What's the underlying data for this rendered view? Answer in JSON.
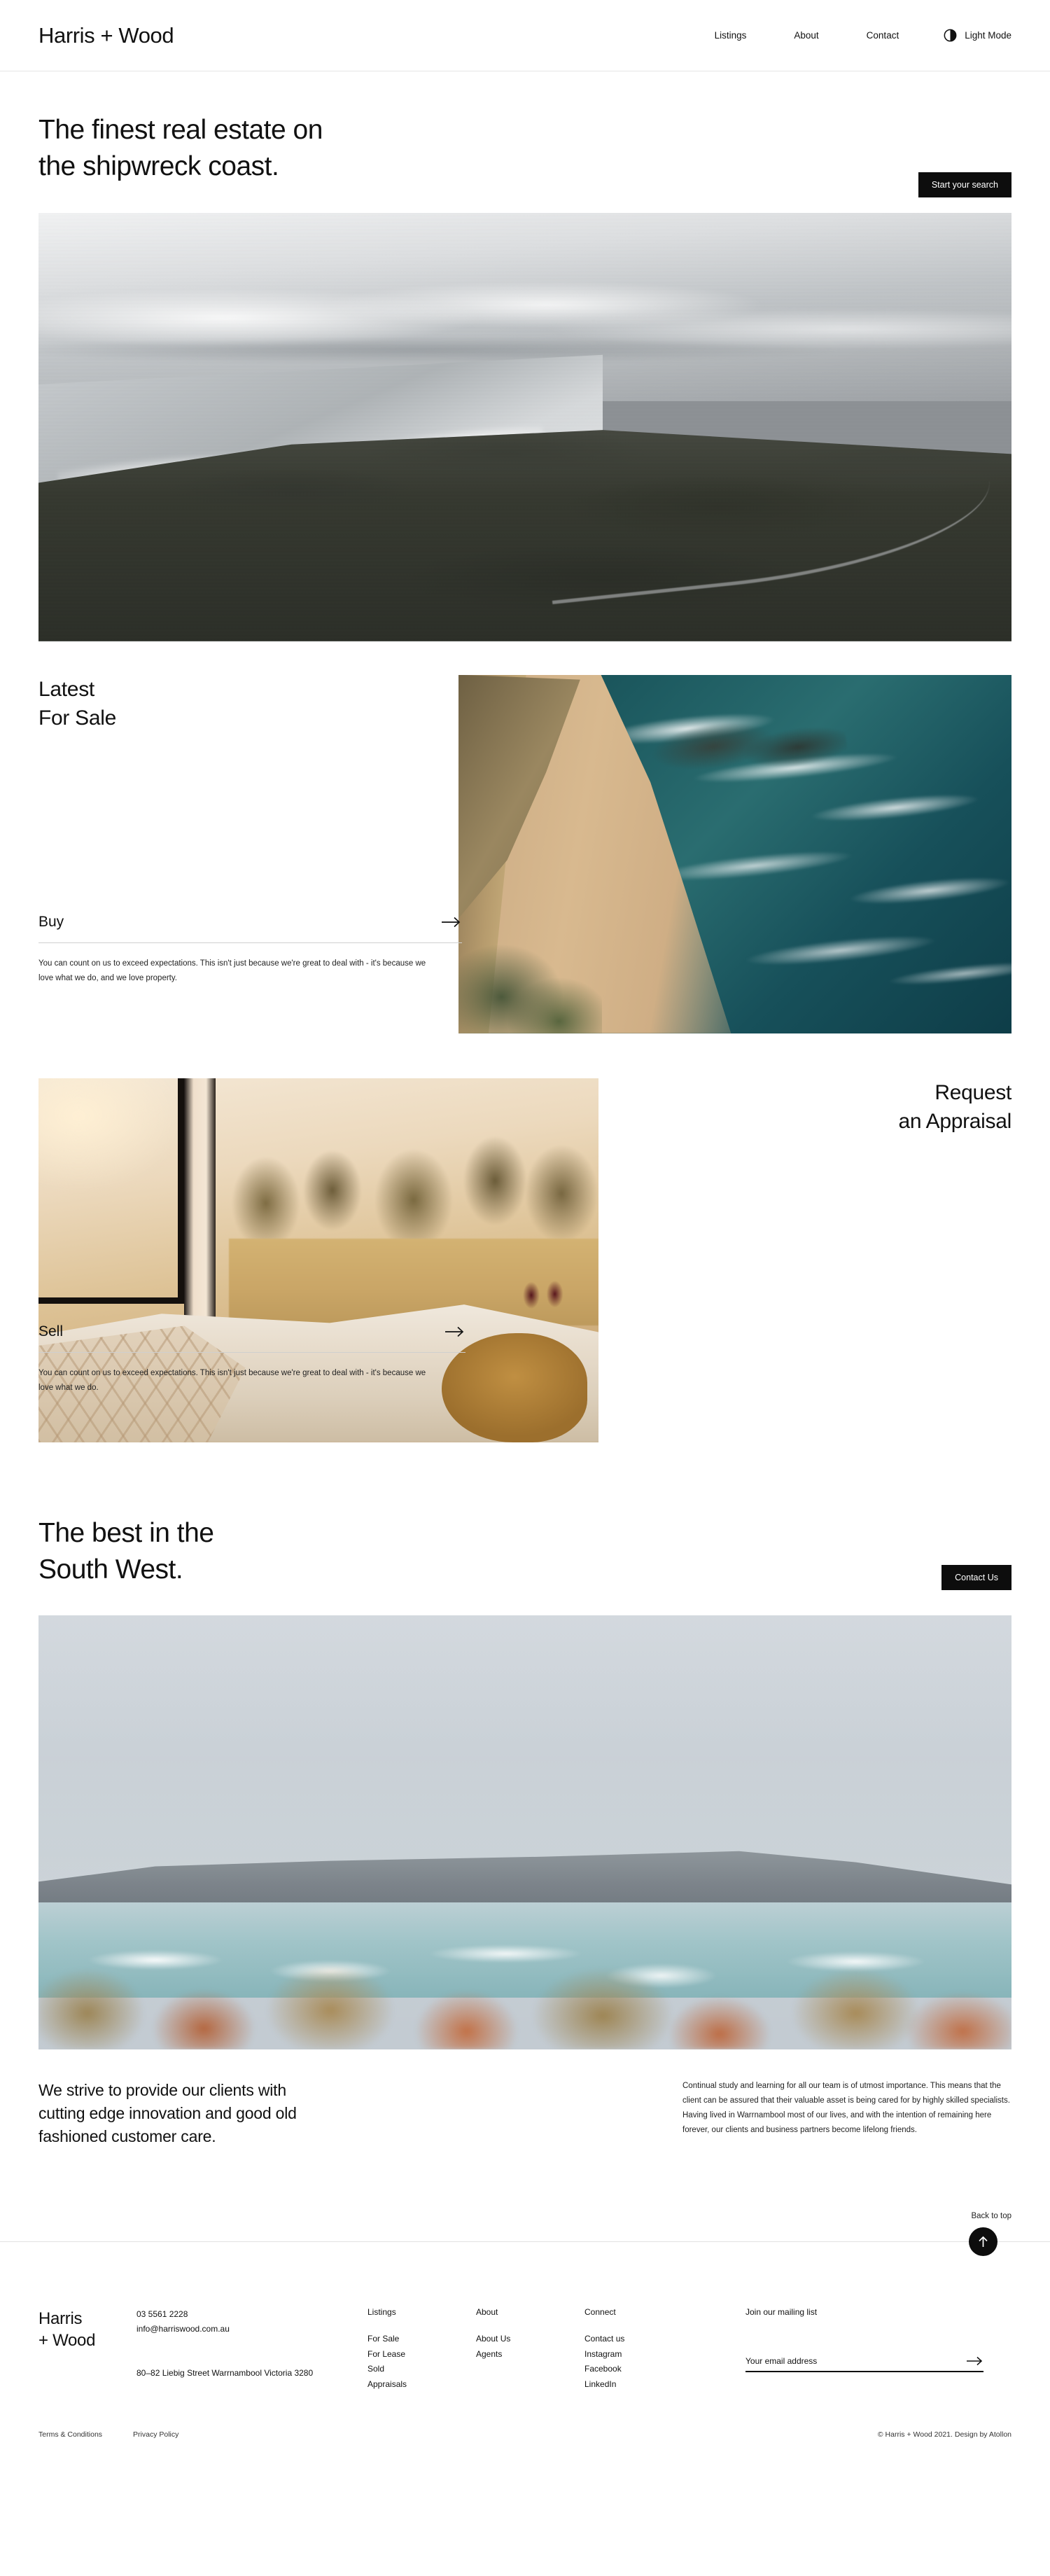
{
  "header": {
    "brand": "Harris + Wood",
    "nav": [
      {
        "label": "Listings"
      },
      {
        "label": "About"
      },
      {
        "label": "Contact"
      }
    ],
    "mode_toggle": {
      "label": "Light Mode",
      "icon": "half-circle-icon"
    }
  },
  "hero": {
    "title": "The finest real estate on\nthe shipwreck coast.",
    "cta": "Start your search"
  },
  "sale": {
    "heading": "Latest\nFor Sale",
    "link_label": "Buy",
    "body": "You can count on us to exceed expectations. This isn't just because we're great to deal with - it's because we love what we do, and we love property."
  },
  "appraisal": {
    "heading": "Request\nan Appraisal",
    "link_label": "Sell",
    "body": "You can count on us to exceed expectations. This isn't just because we're great to deal with - it's because we love what we do."
  },
  "southwest": {
    "title": "The best in the\nSouth West.",
    "cta": "Contact Us"
  },
  "strive": {
    "heading": "We strive to provide our clients with\ncutting edge innovation and good old\nfashioned customer care.",
    "body": "Continual study and learning for all our team is of utmost importance. This means that the client can be assured that their valuable asset is being cared for by highly skilled specialists.\nHaving lived in Warrnambool most of our lives, and with the intention of remaining here forever, our clients and business partners become lifelong friends."
  },
  "back_to_top": {
    "label": "Back to top",
    "icon": "arrow-up-icon"
  },
  "footer": {
    "brand": "Harris\n+ Wood",
    "phone": "03 5561 2228",
    "email": "info@harriswood.com.au",
    "address": "80–82 Liebig Street\nWarrnambool Victoria 3280",
    "columns": [
      {
        "title": "Listings",
        "links": [
          "For Sale",
          "For Lease",
          "Sold",
          "Appraisals"
        ]
      },
      {
        "title": "About",
        "links": [
          "About Us",
          "Agents"
        ]
      },
      {
        "title": "Connect",
        "links": [
          "Contact us",
          "Instagram",
          "Facebook",
          "LinkedIn"
        ]
      }
    ],
    "mailing": {
      "title": "Join our mailing list",
      "placeholder": "Your email address",
      "value": "",
      "submit_icon": "arrow-right-icon"
    }
  },
  "legal": {
    "terms": "Terms & Conditions",
    "privacy": "Privacy Policy",
    "copyright": "© Harris + Wood 2021. Design by Atollon"
  },
  "colors": {
    "accent": "#0d0d0d",
    "text": "#111111",
    "rule": "#e2e2e2"
  }
}
